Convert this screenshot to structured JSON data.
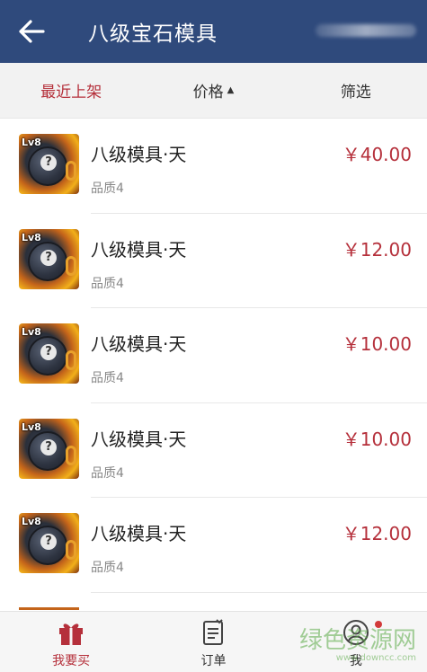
{
  "header": {
    "title": "八级宝石模具"
  },
  "sort": {
    "recent": "最近上架",
    "price": "价格",
    "filter": "筛选"
  },
  "items": [
    {
      "name": "八级模具·天",
      "quality": "品质4",
      "price": "￥40.00",
      "badge": "Lv8"
    },
    {
      "name": "八级模具·天",
      "quality": "品质4",
      "price": "￥12.00",
      "badge": "Lv8"
    },
    {
      "name": "八级模具·天",
      "quality": "品质4",
      "price": "￥10.00",
      "badge": "Lv8"
    },
    {
      "name": "八级模具·天",
      "quality": "品质4",
      "price": "￥10.00",
      "badge": "Lv8"
    },
    {
      "name": "八级模具·天",
      "quality": "品质4",
      "price": "￥12.00",
      "badge": "Lv8"
    }
  ],
  "nav": {
    "buy": "我要买",
    "orders": "订单",
    "me": "我"
  },
  "watermark": {
    "text": "绿色资源网",
    "url": "www.downcc.com"
  },
  "colors": {
    "header_bg": "#2f4a7c",
    "accent": "#b5303b"
  }
}
